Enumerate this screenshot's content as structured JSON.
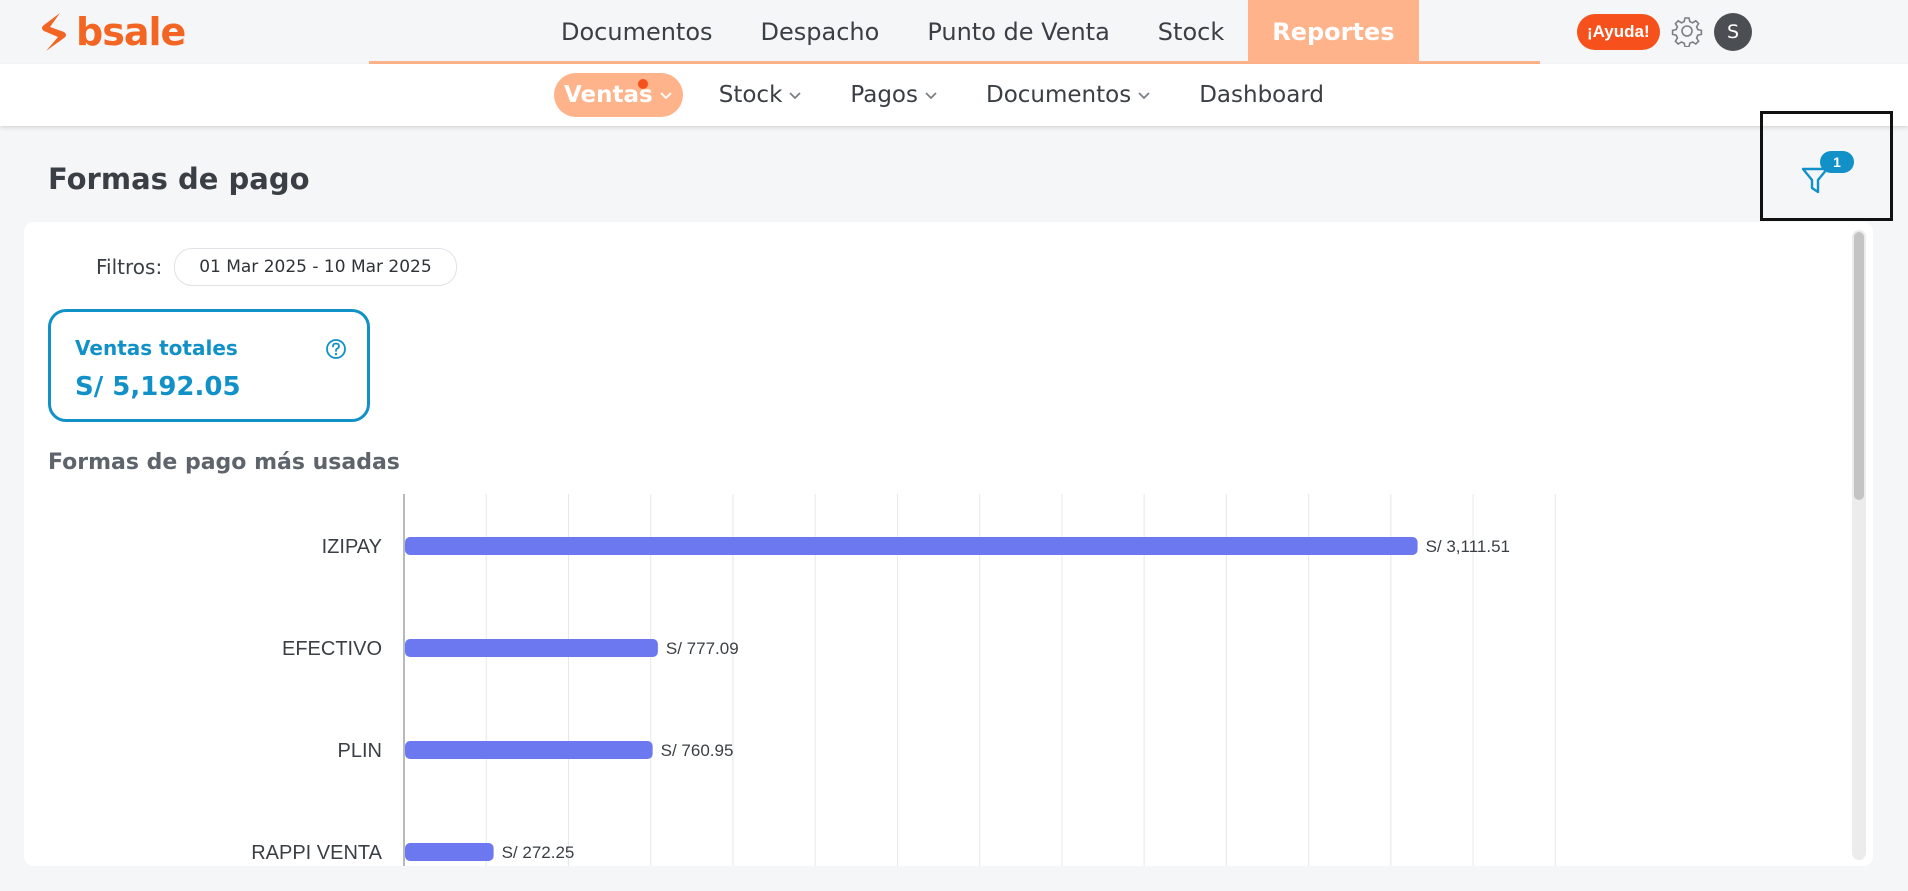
{
  "brand": {
    "name": "bsale",
    "color": "#f26522"
  },
  "main_nav": [
    {
      "label": "Documentos",
      "active": false
    },
    {
      "label": "Despacho",
      "active": false
    },
    {
      "label": "Punto de Venta",
      "active": false
    },
    {
      "label": "Stock",
      "active": false
    },
    {
      "label": "Reportes",
      "active": true
    }
  ],
  "header_actions": {
    "help_label": "¡Ayuda!",
    "avatar_initial": "S"
  },
  "sub_nav": [
    {
      "label": "Ventas",
      "active": true,
      "dropdown": true,
      "notification_dot": true
    },
    {
      "label": "Stock",
      "active": false,
      "dropdown": true
    },
    {
      "label": "Pagos",
      "active": false,
      "dropdown": true
    },
    {
      "label": "Documentos",
      "active": false,
      "dropdown": true
    },
    {
      "label": "Dashboard",
      "active": false,
      "dropdown": false
    }
  ],
  "page": {
    "title": "Formas de pago",
    "filter_badge_count": "1"
  },
  "filters": {
    "label": "Filtros:",
    "date_range": "01 Mar 2025 - 10 Mar 2025"
  },
  "kpi": {
    "label": "Ventas totales",
    "value": "S/ 5,192.05"
  },
  "section": {
    "title": "Formas de pago más usadas"
  },
  "chart_data": {
    "type": "bar",
    "orientation": "horizontal",
    "categories": [
      "IZIPAY",
      "EFECTIVO",
      "PLIN",
      "RAPPI VENTA"
    ],
    "values": [
      3111.51,
      777.09,
      760.95,
      272.25
    ],
    "data_labels": [
      "S/ 3,111.51",
      "S/ 777.09",
      "S/ 760.95",
      "S/ 272.25"
    ],
    "xlim": [
      0,
      3500
    ],
    "grid": true,
    "bar_color": "#6b78f0"
  },
  "colors": {
    "accent_orange": "#ffb38a",
    "help_red": "#f6511d",
    "primary_blue": "#1191c8"
  }
}
